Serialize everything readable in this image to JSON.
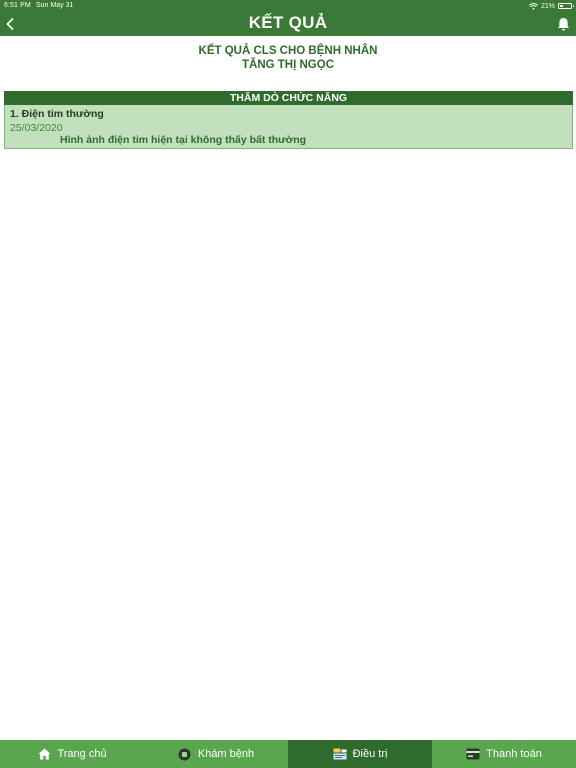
{
  "status_bar": {
    "time": "6:51 PM",
    "date": "Sun May 31",
    "battery": "21%"
  },
  "header": {
    "title": "KẾT QUẢ"
  },
  "patient": {
    "line1": "KẾT QUẢ CLS CHO BỆNH NHÂN",
    "line2": "TĂNG THỊ NGỌC"
  },
  "section": {
    "title": "THĂM DÒ CHỨC NĂNG",
    "results": [
      {
        "name": "1. Điện tim thường",
        "date": "25/03/2020",
        "conclusion": "Hình ảnh điện tim hiện tại không thấy bất thường"
      }
    ]
  },
  "tabs": [
    {
      "label": "Trang chủ",
      "icon": "home-icon"
    },
    {
      "label": "Khám bệnh",
      "icon": "exam-icon"
    },
    {
      "label": "Điều trị",
      "icon": "treatment-icon",
      "active": true
    },
    {
      "label": "Thanh toán",
      "icon": "wallet-icon"
    }
  ],
  "colors": {
    "primary_green": "#3a7a36",
    "dark_green": "#2f6b2c",
    "card_green": "#c2e0bd",
    "tab_green": "#5aa64f"
  }
}
